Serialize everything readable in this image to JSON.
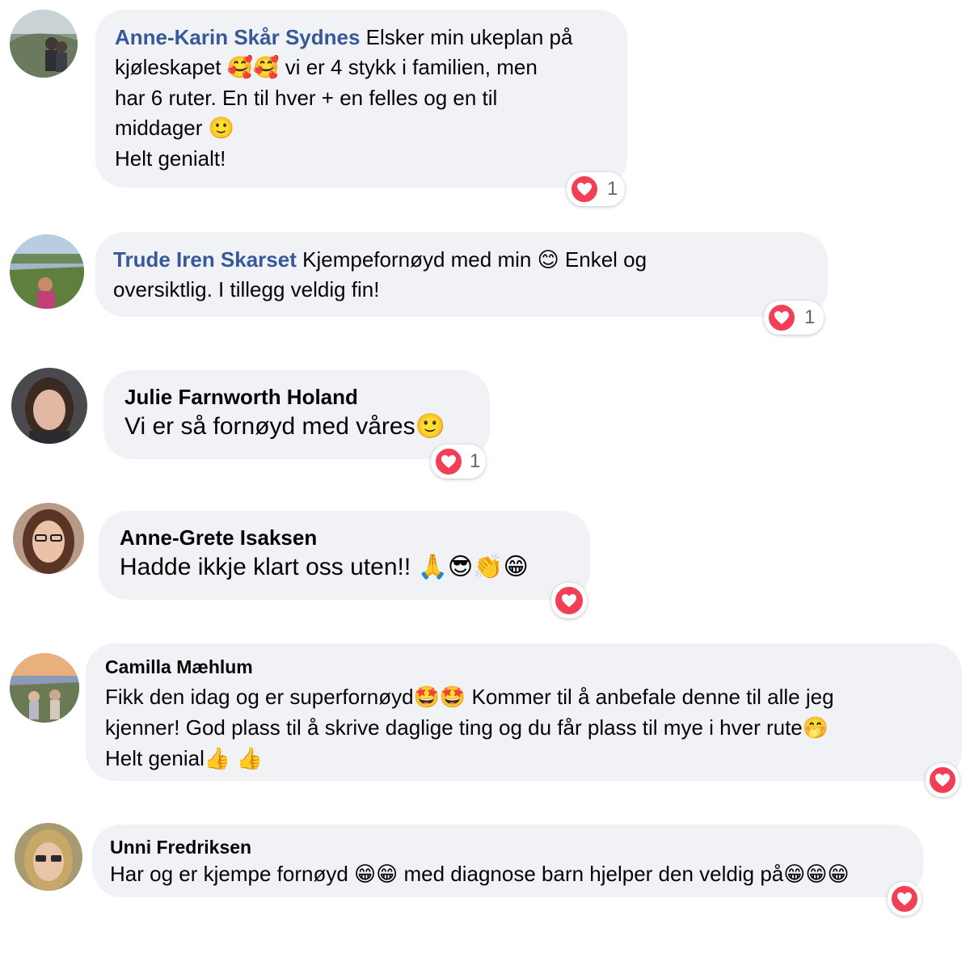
{
  "colors": {
    "bubble": "#f0f2f5",
    "name_link": "#385898",
    "heart": "#f33e58",
    "count_text": "#65676b"
  },
  "comments": [
    {
      "name": "Anne-Karin Skår Sydnes",
      "lines": [
        "Elsker min ukeplan på",
        "kjøleskapet ",
        " vi er 4 stykk i familien, men",
        "har 6 ruter. En til hver + en felles og en til",
        "middager ",
        "Helt genialt!"
      ],
      "emoji": [
        "🥰",
        "🥰",
        "🙂"
      ],
      "reaction": {
        "icon": "heart-icon",
        "count": "1"
      }
    },
    {
      "name": "Trude Iren Skarset",
      "lines": [
        "Kjempefornøyd med min ",
        " Enkel og",
        "oversiktlig. I tillegg veldig fin!"
      ],
      "emoji": [
        "😊"
      ],
      "reaction": {
        "icon": "heart-icon",
        "count": "1"
      }
    },
    {
      "name": "Julie Farnworth Holand",
      "lines": [
        "Vi er så fornøyd med våres"
      ],
      "emoji": [
        "🙂"
      ],
      "reaction": {
        "icon": "heart-icon",
        "count": "1"
      }
    },
    {
      "name": "Anne-Grete Isaksen",
      "lines": [
        "Hadde ikkje klart oss uten!! "
      ],
      "emoji": [
        "🙏",
        "😎",
        "👏",
        "😁"
      ],
      "reaction": {
        "icon": "heart-icon"
      }
    },
    {
      "name": "Camilla Mæhlum",
      "lines": [
        "Fikk den idag og er superfornøyd",
        " Kommer til å anbefale denne til alle jeg",
        "kjenner! God plass til å skrive daglige ting og du får plass til mye i hver rute",
        "Helt genial"
      ],
      "emoji": [
        "🤩",
        "🤩",
        "🤭",
        "👍",
        "👍"
      ],
      "reaction": {
        "icon": "heart-icon"
      }
    },
    {
      "name": "Unni Fredriksen",
      "lines": [
        "Har og er kjempe fornøyd ",
        " med diagnose barn hjelper den veldig på"
      ],
      "emoji": [
        "😁",
        "😁",
        "😁",
        "😁",
        "😁"
      ],
      "reaction": {
        "icon": "heart-icon"
      }
    }
  ]
}
